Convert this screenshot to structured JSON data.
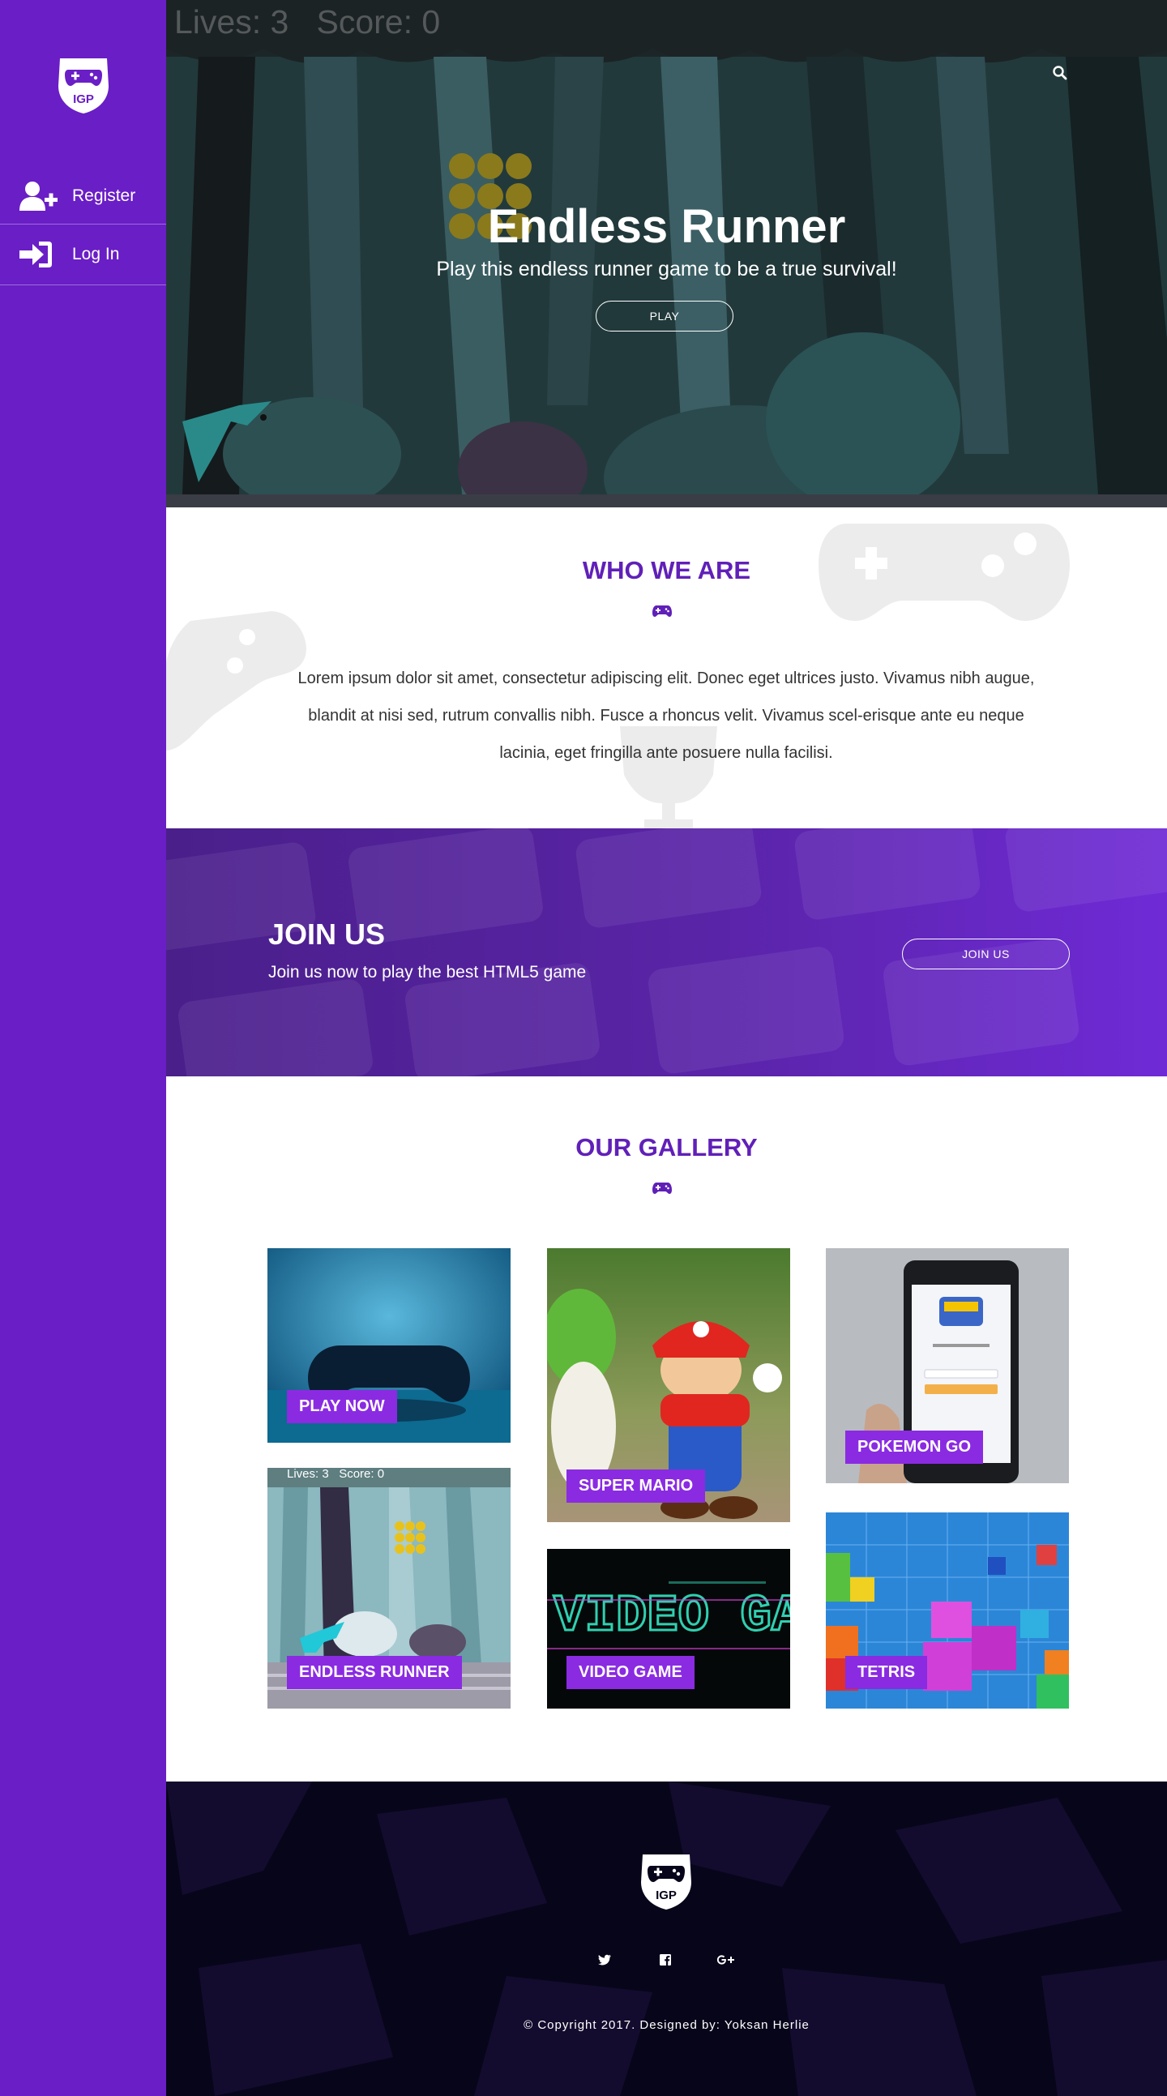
{
  "sidebar": {
    "logo_text": "IGP",
    "items": [
      {
        "label": "Register",
        "icon": "add-user-icon"
      },
      {
        "label": "Log In",
        "icon": "sign-in-icon"
      }
    ]
  },
  "hero": {
    "hud": "Lives: 3   Score: 0",
    "title": "Endless Runner",
    "subtitle": "Play this endless runner game to be a true survival!",
    "button": "PLAY"
  },
  "about": {
    "title": "WHO WE ARE",
    "text": "Lorem ipsum dolor sit amet, consectetur adipiscing elit. Donec eget ultrices justo. Vivamus nibh augue, blandit at nisi sed, rutrum convallis nibh. Fusce a rhoncus velit. Vivamus scel-erisque ante eu neque lacinia, eget fringilla ante posuere nulla facilisi."
  },
  "join": {
    "title": "JOIN US",
    "subtitle": "Join us now to play the best HTML5 game",
    "button": "JOIN US"
  },
  "gallery": {
    "title": "OUR GALLERY",
    "items": [
      {
        "label": "PLAY NOW"
      },
      {
        "label": "ENDLESS RUNNER",
        "hud": "Lives: 3   Score: 0"
      },
      {
        "label": "SUPER MARIO"
      },
      {
        "label": "VIDEO GAME",
        "art_text": "VIDEO GAMES"
      },
      {
        "label": "POKEMON GO"
      },
      {
        "label": "TETRIS"
      }
    ]
  },
  "footer": {
    "logo_text": "IGP",
    "social": [
      "twitter-icon",
      "facebook-icon",
      "google-plus-icon"
    ],
    "copyright": "© Copyright 2017. Designed by: Yoksan Herlie"
  },
  "colors": {
    "sidebar": "#6a1ec6",
    "accent": "#6020b8",
    "label_bg": "#8a2be2",
    "footer": "#07051a"
  }
}
